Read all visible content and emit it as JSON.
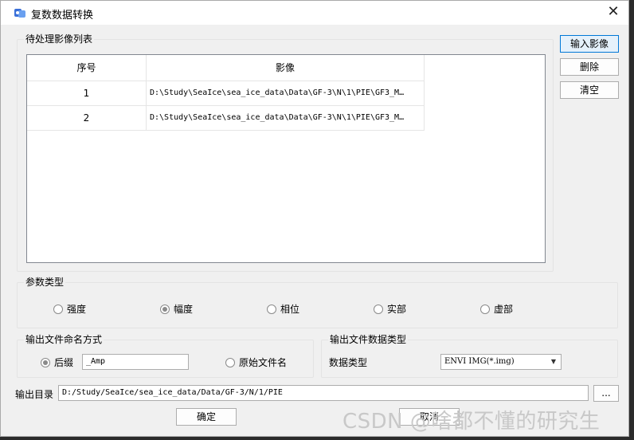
{
  "window": {
    "title": "复数数据转换",
    "close_glyph": "✕",
    "icon": "app-icon"
  },
  "image_list": {
    "group_title": "待处理影像列表",
    "columns": [
      "序号",
      "影像"
    ],
    "rows": [
      {
        "index": "1",
        "path": "D:\\Study\\SeaIce\\sea_ice_data\\Data\\GF-3\\N\\1\\PIE\\GF3_M…"
      },
      {
        "index": "2",
        "path": "D:\\Study\\SeaIce\\sea_ice_data\\Data\\GF-3\\N\\1\\PIE\\GF3_M…"
      }
    ]
  },
  "side_buttons": {
    "input": "输入影像",
    "delete": "删除",
    "clear": "清空"
  },
  "param_type": {
    "group_title": "参数类型",
    "options": [
      "强度",
      "幅度",
      "相位",
      "实部",
      "虚部"
    ],
    "selected": "幅度"
  },
  "output_naming": {
    "group_title": "输出文件命名方式",
    "suffix_label": "后缀",
    "suffix_value": "_Amp",
    "original_label": "原始文件名",
    "selected": "后缀"
  },
  "output_data_type": {
    "group_title": "输出文件数据类型",
    "label": "数据类型",
    "value": "ENVI IMG(*.img)"
  },
  "output_dir": {
    "label": "输出目录",
    "value": "D:/Study/SeaIce/sea_ice_data/Data/GF-3/N/1/PIE",
    "browse": "..."
  },
  "footer": {
    "ok": "确定",
    "cancel": "取消"
  },
  "watermark": "CSDN @啥都不懂的研究生",
  "colors": {
    "primary_border": "#0078d7",
    "window_bg": "#f0f0f0"
  }
}
